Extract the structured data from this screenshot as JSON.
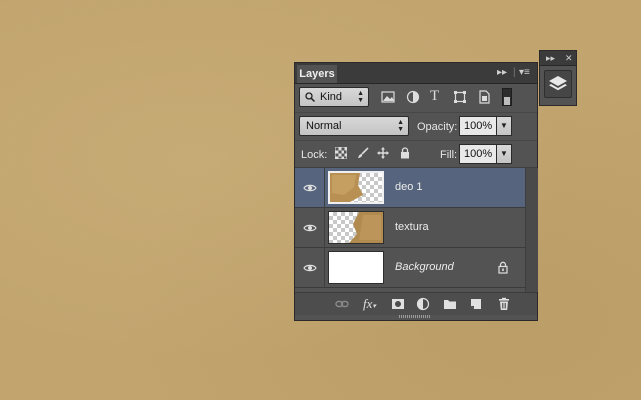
{
  "panel": {
    "tab": "Layers",
    "filter": {
      "kind_label": "Kind"
    },
    "blend_mode": "Normal",
    "opacity": {
      "label": "Opacity:",
      "value": "100%"
    },
    "lock": {
      "label": "Lock:"
    },
    "fill": {
      "label": "Fill:",
      "value": "100%"
    },
    "layers": [
      {
        "name": "deo 1",
        "selected": true
      },
      {
        "name": "textura",
        "selected": false
      },
      {
        "name": "Background",
        "locked": true
      }
    ],
    "footer_icons": [
      "link-icon",
      "fx-icon",
      "mask-icon",
      "adjustment-icon",
      "folder-icon",
      "new-layer-icon",
      "trash-icon"
    ]
  },
  "dock": {
    "icon": "layers-icon"
  },
  "colors": {
    "panel": "#535353",
    "panel_header": "#3b3b3b",
    "selection": "#56657d",
    "canvas": "#c3a56e"
  }
}
